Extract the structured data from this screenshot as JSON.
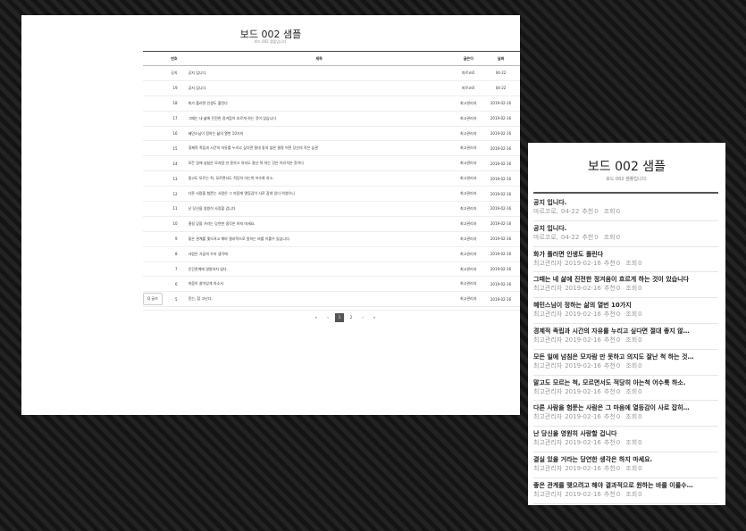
{
  "board": {
    "title": "보드 002 샘플",
    "subtitle": "보드 002 샘플입니다.",
    "columns": [
      "번호",
      "제목",
      "글쓴이",
      "날짜",
      "추천",
      "조회"
    ],
    "rows": [
      {
        "no": "공지",
        "subject": "공지 입니다.",
        "author": "마르코로",
        "date": "04-22",
        "recommend": "0",
        "views": "0"
      },
      {
        "no": "19",
        "subject": "공지 입니다.",
        "author": "마르코로",
        "date": "04-22",
        "recommend": "0",
        "views": "0"
      },
      {
        "no": "18",
        "subject": "화가 폴러면 인생도 폴린다",
        "author": "최고관리자",
        "date": "2019-02-16",
        "recommend": "0",
        "views": "0"
      },
      {
        "no": "17",
        "subject": "그때는 네 삶에 진전한 정겨움이 흐르게 하는 것이 있습니다",
        "author": "최고관리자",
        "date": "2019-02-16",
        "recommend": "0",
        "views": "0"
      },
      {
        "no": "16",
        "subject": "혜민스님이 정하는 삶의 열번 10가지",
        "author": "최고관리자",
        "date": "2019-02-16",
        "recommend": "0",
        "views": "0"
      },
      {
        "no": "15",
        "subject": "경제적 족립과 시간의 자유를 누리고 싶다면 절대 좋지 않은 결정 어떤 당신의 작은 습관",
        "author": "최고관리자",
        "date": "2019-02-16",
        "recommend": "0",
        "views": "0"
      },
      {
        "no": "14",
        "subject": "모든 일에 넘침은 모자람 만 못하고 의지도 잘난 척 하는 것은 어리석은 짓이다",
        "author": "최고관리자",
        "date": "2019-02-16",
        "recommend": "0",
        "views": "0"
      },
      {
        "no": "13",
        "subject": "말고도 모르는 척, 모르면서도 적당히 아는척 어수룩 하소.",
        "author": "최고관리자",
        "date": "2019-02-16",
        "recommend": "0",
        "views": "0"
      },
      {
        "no": "12",
        "subject": "다른 사람을 험쭌는 사람은 그 마음에 열등감이 사로 잡혀 있다 하였으니",
        "author": "최고관리자",
        "date": "2019-02-16",
        "recommend": "0",
        "views": "0"
      },
      {
        "no": "11",
        "subject": "난 당신을 영원히 사랑할 겁니다",
        "author": "최고관리자",
        "date": "2019-02-16",
        "recommend": "0",
        "views": "0"
      },
      {
        "no": "10",
        "subject": "결실 있을 거라는 당연한 생각은 하지 마세요.",
        "author": "최고관리자",
        "date": "2019-02-16",
        "recommend": "0",
        "views": "0"
      },
      {
        "no": "9",
        "subject": "좋은 관계를 맺으려고 해야 결과적으로 원하는 바를 이룰수 있습니다.",
        "author": "최고관리자",
        "date": "2019-02-16",
        "recommend": "0",
        "views": "0"
      },
      {
        "no": "8",
        "subject": "사람은 가끔씩 우리 생각에",
        "author": "최고관리자",
        "date": "2019-02-16",
        "recommend": "0",
        "views": "0"
      },
      {
        "no": "7",
        "subject": "인간관계에 영원하지 않다.",
        "author": "최고관리자",
        "date": "2019-02-16",
        "recommend": "0",
        "views": "0"
      },
      {
        "no": "6",
        "subject": "마음이 살아있게 하소서",
        "author": "최고관리자",
        "date": "2019-02-16",
        "recommend": "0",
        "views": "0"
      },
      {
        "no": "5",
        "subject": "웃는, 참 고난다.",
        "author": "최고관리자",
        "date": "2019-02-16",
        "recommend": "0",
        "views": "0"
      }
    ],
    "write_label": "Q 글쓰",
    "pager": {
      "first": "«",
      "prev": "‹",
      "pages": [
        "1",
        "2"
      ],
      "active": "1",
      "next": "›",
      "last": "»"
    }
  },
  "mobile": {
    "title": "보드 002 샘플",
    "subtitle": "보드 002 샘플입니다.",
    "recommend_label": "추천",
    "views_label": "조회",
    "items": [
      {
        "subject": "공지 입니다.",
        "author": "마르코로,",
        "date": "04-22",
        "recommend": "0",
        "views": "0"
      },
      {
        "subject": "공지 입니다.",
        "author": "마르코로,",
        "date": "04-22",
        "recommend": "0",
        "views": "0"
      },
      {
        "subject": "화가 폴러면 인생도 폴린다",
        "author": "최고관리자",
        "date": "2019-02-16",
        "recommend": "0",
        "views": "0"
      },
      {
        "subject": "그때는 네 삶에 진전한 정겨움이 흐르게 하는 것이 있습니다",
        "author": "최고관리자",
        "date": "2019-02-16",
        "recommend": "0",
        "views": "0"
      },
      {
        "subject": "혜민스님이 정하는 삶의 열번 10가지",
        "author": "최고관리자",
        "date": "2019-02-16",
        "recommend": "0",
        "views": "0"
      },
      {
        "subject": "경제적 족립과 시간의 자유를 누리고 싶다면 절대 좋지 않…",
        "author": "최고관리자",
        "date": "2019-02-16",
        "recommend": "0",
        "views": "0"
      },
      {
        "subject": "모든 일에 넘침은 모자람 만 못하고 의지도 잘난 척 하는 것…",
        "author": "최고관리자",
        "date": "2019-02-16",
        "recommend": "0",
        "views": "0"
      },
      {
        "subject": "말고도 모르는 척, 모르면서도 적당히 아는척 어수룩 하소.",
        "author": "최고관리자",
        "date": "2019-02-16",
        "recommend": "0",
        "views": "0"
      },
      {
        "subject": "다른 사람을 험쭌는 사람은 그 마음에 열등감이 사로 잡히…",
        "author": "최고관리자",
        "date": "2019-02-16",
        "recommend": "0",
        "views": "0"
      },
      {
        "subject": "난 당신을 영원히 사랑할 겁니다",
        "author": "최고관리자",
        "date": "2019-02-16",
        "recommend": "0",
        "views": "0"
      },
      {
        "subject": "결실 있을 거라는 당연한 생각은 하지 마세요.",
        "author": "최고관리자",
        "date": "2019-02-16",
        "recommend": "0",
        "views": "0"
      },
      {
        "subject": "좋은 관계를 맺으려고 해야 결과적으로 원하는 바를 이룰수…",
        "author": "최고관리자",
        "date": "2019-02-16",
        "recommend": "0",
        "views": "0"
      }
    ]
  }
}
